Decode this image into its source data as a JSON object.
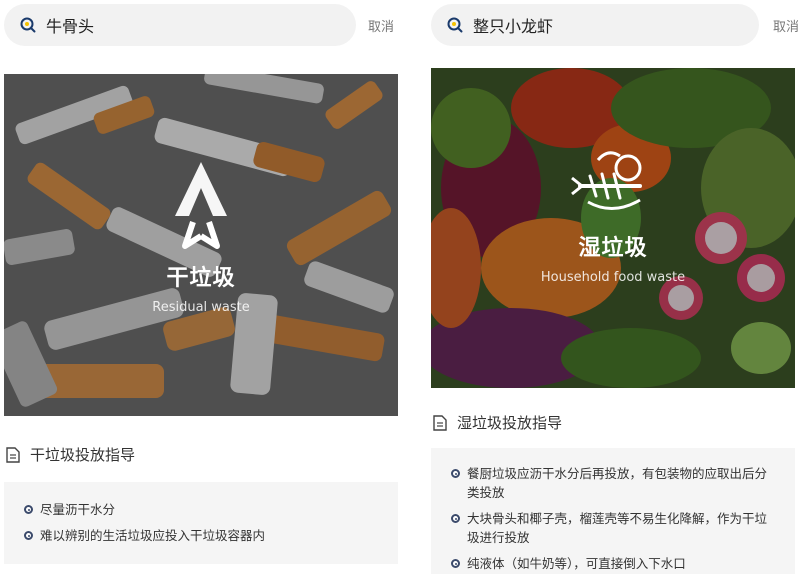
{
  "left": {
    "search": {
      "query": "牛骨头",
      "cancel_label": "取消"
    },
    "hero": {
      "title": "干垃圾",
      "subtitle": "Residual waste",
      "icon": "residual-waste-arrows-icon"
    },
    "guide": {
      "title": "干垃圾投放指导",
      "items": [
        "尽量沥干水分",
        "难以辨别的生活垃圾应投入干垃圾容器内"
      ]
    }
  },
  "right": {
    "search": {
      "query": "整只小龙虾",
      "cancel_label": "取消"
    },
    "hero": {
      "title": "湿垃圾",
      "subtitle": "Household food waste",
      "icon": "food-waste-fish-bone-icon"
    },
    "guide": {
      "title": "湿垃圾投放指导",
      "items": [
        "餐厨垃圾应沥干水分后再投放，有包装物的应取出后分类投放",
        "大块骨头和椰子壳，榴莲壳等不易生化降解，作为干垃圾进行投放",
        "纯液体（如牛奶等），可直接倒入下水口"
      ]
    }
  },
  "colors": {
    "search_bg": "#f2f2f2",
    "search_icon_ring": "#1a3a6b",
    "search_icon_dot": "#f5c200",
    "bullet": "#3b4a6b"
  }
}
